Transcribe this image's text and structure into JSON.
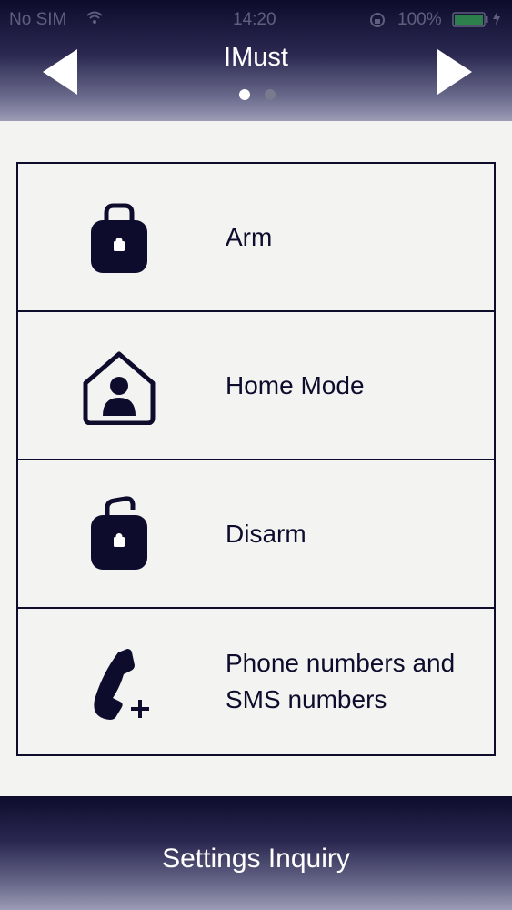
{
  "status_bar": {
    "carrier": "No SIM",
    "time": "14:20",
    "battery_percent": "100%",
    "wifi_icon": "wifi-icon",
    "battery_color": "#3ed65a"
  },
  "header": {
    "title": "IMust",
    "prev_icon": "left-arrow-icon",
    "next_icon": "right-arrow-icon",
    "page_indicator": {
      "total": 2,
      "active": 1
    }
  },
  "menu": {
    "items": [
      {
        "label": "Arm",
        "icon": "locked-padlock-icon"
      },
      {
        "label": "Home Mode",
        "icon": "home-person-icon"
      },
      {
        "label": "Disarm",
        "icon": "unlocked-padlock-icon"
      },
      {
        "label": "Phone numbers and\nSMS numbers",
        "icon": "phone-add-icon"
      }
    ]
  },
  "footer": {
    "label": "Settings Inquiry"
  },
  "colors": {
    "primary": "#0e0c2c",
    "background": "#f3f3f1",
    "text_light": "#ffffff"
  }
}
